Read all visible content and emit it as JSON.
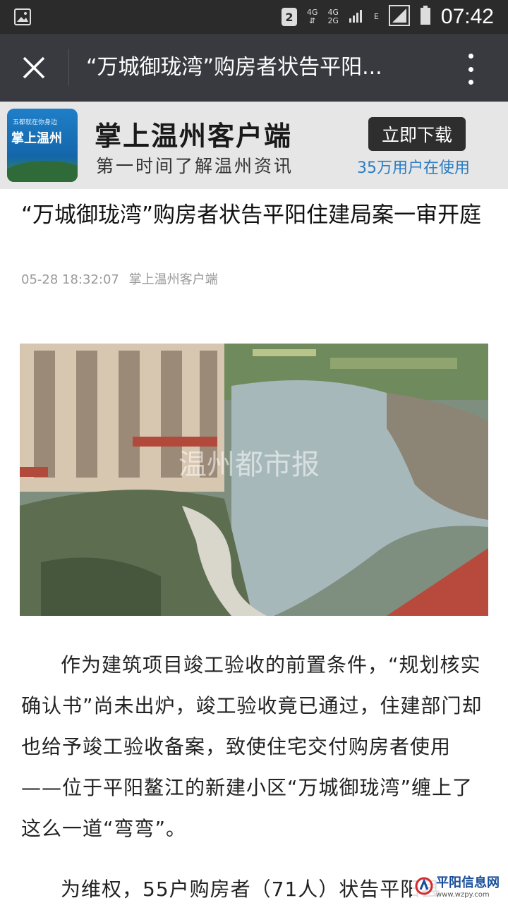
{
  "status_bar": {
    "sim_slot": "2",
    "network_a": "4G",
    "network_b_top": "4G",
    "network_b_bottom": "2G",
    "network_c": "E",
    "time": "07:42"
  },
  "title_bar": {
    "title": "“万城御珑湾”购房者状告平阳..."
  },
  "banner": {
    "logo_small_text": "五都就在你身边",
    "logo_name": "掌上温州",
    "title": "掌上温州客户端",
    "subtitle": "第一时间了解温州资讯",
    "download_label": "立即下载",
    "users_note": "35万用户在使用"
  },
  "article": {
    "title": "“万城御珑湾”购房者状告平阳住建局案一审开庭",
    "date": "05-28 18:32:07",
    "source": "掌上温州客户端",
    "photo_watermark": "温州都市报",
    "paragraph1": "作为建筑项目竣工验收的前置条件，“规划核实确认书”尚未出炉，竣工验收竟已通过，住建部门却也给予竣工验收备案，致使住宅交付购房者使用——位于平阳鳌江的新建小区“万城御珑湾”缠上了这么一道“弯弯”。",
    "paragraph2": "为维权，55户购房者（71人）状告平阳县"
  },
  "site_watermark": {
    "name": "平阳信息网",
    "url": "www.wzpy.com"
  }
}
